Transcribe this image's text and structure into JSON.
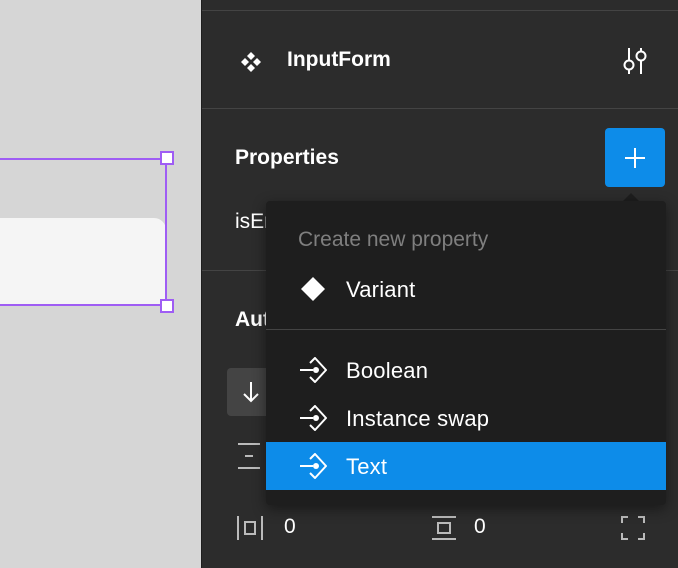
{
  "panel": {
    "component_name": "InputForm",
    "properties_title": "Properties",
    "property_row_label": "isEr",
    "autolayout_title": "Auto layout",
    "padding_horizontal": "0",
    "padding_vertical": "0"
  },
  "menu": {
    "header": "Create new property",
    "items": [
      {
        "label": "Variant",
        "icon": "diamond-icon"
      },
      {
        "label": "Boolean",
        "icon": "property-icon"
      },
      {
        "label": "Instance swap",
        "icon": "property-icon"
      },
      {
        "label": "Text",
        "icon": "property-icon",
        "selected": true
      }
    ]
  },
  "colors": {
    "accent": "#0d8ce9",
    "selection": "#9f5df4",
    "panel_bg": "#2c2c2c",
    "menu_bg": "#1e1e1e",
    "canvas_bg": "#d6d6d6"
  }
}
